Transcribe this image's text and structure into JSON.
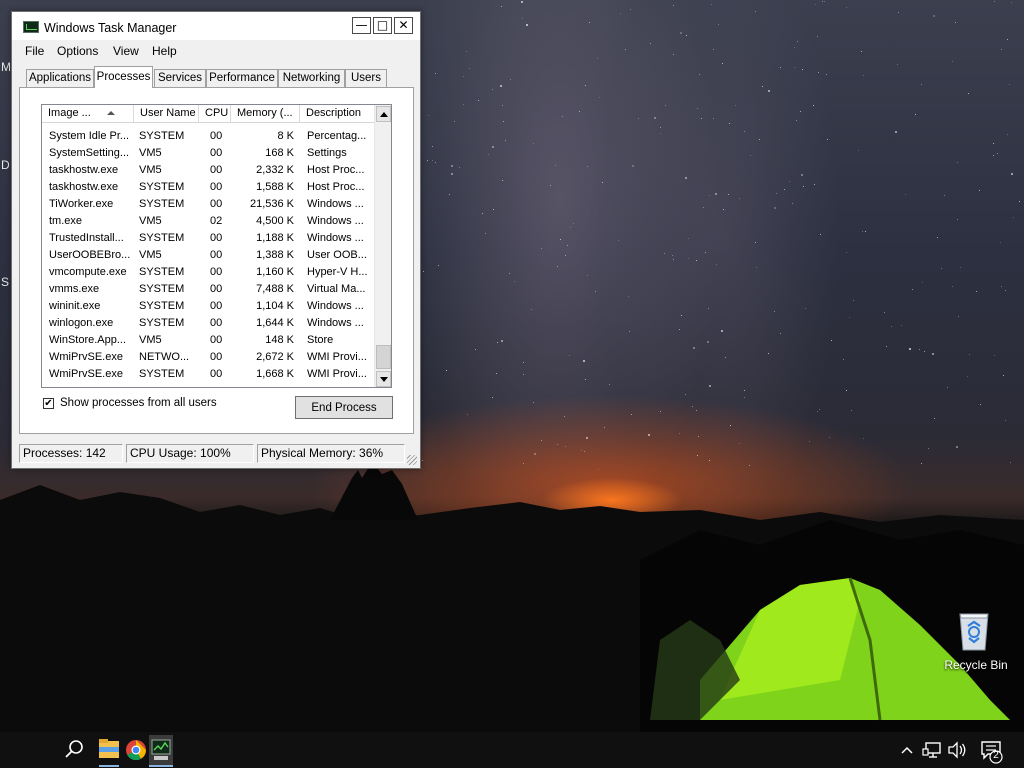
{
  "window": {
    "title": "Windows Task Manager",
    "minimize_glyph": "—",
    "maximize_glyph": "□",
    "close_glyph": "✕"
  },
  "menu": [
    "File",
    "Options",
    "View",
    "Help"
  ],
  "tabs": [
    "Applications",
    "Processes",
    "Services",
    "Performance",
    "Networking",
    "Users"
  ],
  "active_tab": "Processes",
  "columns": [
    "Image ...",
    "User Name",
    "CPU",
    "Memory (...",
    "Description"
  ],
  "processes": [
    {
      "image": "System Idle Pr...",
      "user": "SYSTEM",
      "cpu": "00",
      "memory": "8 K",
      "description": "Percentag..."
    },
    {
      "image": "SystemSetting...",
      "user": "VM5",
      "cpu": "00",
      "memory": "168 K",
      "description": "Settings"
    },
    {
      "image": "taskhostw.exe",
      "user": "VM5",
      "cpu": "00",
      "memory": "2,332 K",
      "description": "Host Proc..."
    },
    {
      "image": "taskhostw.exe",
      "user": "SYSTEM",
      "cpu": "00",
      "memory": "1,588 K",
      "description": "Host Proc..."
    },
    {
      "image": "TiWorker.exe",
      "user": "SYSTEM",
      "cpu": "00",
      "memory": "21,536 K",
      "description": "Windows ..."
    },
    {
      "image": "tm.exe",
      "user": "VM5",
      "cpu": "02",
      "memory": "4,500 K",
      "description": "Windows ..."
    },
    {
      "image": "TrustedInstall...",
      "user": "SYSTEM",
      "cpu": "00",
      "memory": "1,188 K",
      "description": "Windows ..."
    },
    {
      "image": "UserOOBEBro...",
      "user": "VM5",
      "cpu": "00",
      "memory": "1,388 K",
      "description": "User OOB..."
    },
    {
      "image": "vmcompute.exe",
      "user": "SYSTEM",
      "cpu": "00",
      "memory": "1,160 K",
      "description": "Hyper-V H..."
    },
    {
      "image": "vmms.exe",
      "user": "SYSTEM",
      "cpu": "00",
      "memory": "7,488 K",
      "description": "Virtual Ma..."
    },
    {
      "image": "wininit.exe",
      "user": "SYSTEM",
      "cpu": "00",
      "memory": "1,104 K",
      "description": "Windows ..."
    },
    {
      "image": "winlogon.exe",
      "user": "SYSTEM",
      "cpu": "00",
      "memory": "1,644 K",
      "description": "Windows ..."
    },
    {
      "image": "WinStore.App...",
      "user": "VM5",
      "cpu": "00",
      "memory": "148 K",
      "description": "Store"
    },
    {
      "image": "WmiPrvSE.exe",
      "user": "NETWO...",
      "cpu": "00",
      "memory": "2,672 K",
      "description": "WMI Provi..."
    },
    {
      "image": "WmiPrvSE.exe",
      "user": "SYSTEM",
      "cpu": "00",
      "memory": "1,668 K",
      "description": "WMI Provi..."
    }
  ],
  "show_all_label": "Show processes from all users",
  "show_all_checked": true,
  "checkbox_glyph": "✔",
  "end_process_label": "End Process",
  "status": {
    "processes": "Processes: 142",
    "cpu": "CPU Usage: 100%",
    "memory": "Physical Memory: 36%"
  },
  "desktop": {
    "recycle_bin_label": "Recycle Bin",
    "edge_letters": [
      "M",
      "D",
      "S"
    ]
  },
  "taskbar": {
    "notification_count": "2",
    "icons": [
      "search-icon",
      "file-explorer-icon",
      "chrome-icon",
      "task-manager-icon",
      "chevron-up-icon",
      "network-icon",
      "volume-icon",
      "action-center-icon"
    ]
  }
}
